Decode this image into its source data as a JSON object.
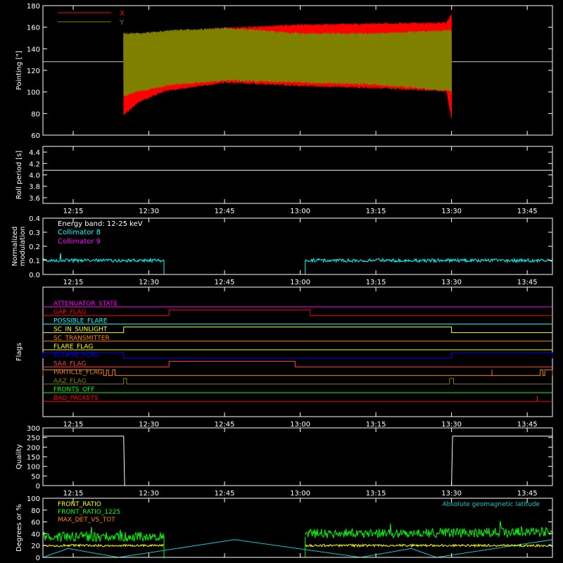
{
  "chart_data": [
    {
      "id": "pointing",
      "type": "line",
      "ylabel": "Pointing [\"]",
      "ylim": [
        60,
        180
      ],
      "yticks": [
        60,
        80,
        100,
        120,
        140,
        160,
        180
      ],
      "xticks": [
        "12:15",
        "12:30",
        "12:45",
        "13:00",
        "13:15",
        "13:30",
        "13:45"
      ],
      "show_xtick_labels": false,
      "legend": [
        {
          "name": "X",
          "color": "#ff0000"
        },
        {
          "name": "Y",
          "color": "#808000"
        }
      ],
      "reference_line": {
        "y": 128,
        "color": "#c8c8c8"
      },
      "series": [
        {
          "name": "X",
          "color": "#ff0000",
          "x_range": [
            "12:25",
            "13:30"
          ],
          "envelope_keypoints": [
            [
              "12:25",
              78,
              150
            ],
            [
              "12:28",
              90,
              150
            ],
            [
              "12:33",
              100,
              155
            ],
            [
              "12:45",
              108,
              160
            ],
            [
              "13:00",
              105,
              163
            ],
            [
              "13:15",
              103,
              164
            ],
            [
              "13:29",
              100,
              165
            ],
            [
              "13:30",
              75,
              173
            ]
          ]
        },
        {
          "name": "Y",
          "color": "#808000",
          "x_range": [
            "12:25",
            "13:30"
          ],
          "envelope_keypoints": [
            [
              "12:25",
              95,
              155
            ],
            [
              "12:28",
              100,
              155
            ],
            [
              "12:35",
              106,
              158
            ],
            [
              "12:45",
              110,
              160
            ],
            [
              "13:00",
              108,
              155
            ],
            [
              "13:15",
              106,
              155
            ],
            [
              "13:30",
              100,
              158
            ]
          ]
        }
      ]
    },
    {
      "id": "roll",
      "type": "line",
      "ylabel": "Roll period [s]",
      "ylim": [
        3.5,
        4.5
      ],
      "yticks": [
        3.6,
        3.8,
        4.0,
        4.2,
        4.4
      ],
      "xticks": [
        "12:15",
        "12:30",
        "12:45",
        "13:00",
        "13:15",
        "13:30",
        "13:45"
      ],
      "show_xtick_labels": true,
      "series": [
        {
          "name": "",
          "color": "#ffffff",
          "x": [
            "12:09",
            "13:50"
          ],
          "y": [
            4.08,
            4.08
          ]
        }
      ]
    },
    {
      "id": "modulation",
      "type": "line",
      "ylabel": "Normalized modulation",
      "ylim": [
        0.0,
        0.4
      ],
      "yticks": [
        0.0,
        0.1,
        0.2,
        0.3,
        0.4
      ],
      "xticks": [
        "12:15",
        "12:30",
        "12:45",
        "13:00",
        "13:15",
        "13:30",
        "13:45"
      ],
      "show_xtick_labels": true,
      "annotation": "Energy band: 12-25 keV",
      "series": [
        {
          "name": "Collimator 8",
          "color": "#00ffff",
          "segments": [
            [
              [
                "12:09",
                0.1
              ],
              [
                "12:33",
                0.1
              ]
            ],
            [
              [
                "13:01",
                0.1
              ],
              [
                "13:50",
                0.1
              ]
            ]
          ],
          "baseline_gap": [
            "12:33",
            "13:01"
          ]
        },
        {
          "name": "Collimator 9",
          "color": "#ff00ff",
          "x": [
            "12:09",
            "13:50"
          ],
          "y": [
            0.0,
            0.0
          ]
        }
      ]
    },
    {
      "id": "flags",
      "type": "line",
      "ylabel": "Flags",
      "xticks": [
        "12:15",
        "12:30",
        "12:45",
        "13:00",
        "13:15",
        "13:30",
        "13:45"
      ],
      "show_xtick_labels": true,
      "flags": [
        {
          "name": "ATTENUATOR_STATE",
          "color": "#ff00ff",
          "highs": []
        },
        {
          "name": "GAP_FLAG",
          "color": "#ff0000",
          "highs": [
            [
              "12:34",
              "13:02"
            ]
          ]
        },
        {
          "name": "POSSIBLE_FLARE",
          "color": "#00ffff",
          "highs": []
        },
        {
          "name": "SC_IN_SUNLIGHT",
          "color": "#ffff00",
          "highs": [
            [
              "12:25",
              "13:30"
            ]
          ]
        },
        {
          "name": "SC_TRANSMITTER",
          "color": "#ff8000",
          "highs": []
        },
        {
          "name": "FLARE_FLAG",
          "color": "#ffff00",
          "highs": []
        },
        {
          "name": "ECLIPSE_FLAG",
          "color": "#0000ff",
          "highs": [
            [
              "12:09",
              "12:25"
            ],
            [
              "13:30",
              "13:50"
            ]
          ]
        },
        {
          "name": "SAA_FLAG",
          "color": "#ff4040",
          "highs": [
            [
              "12:34",
              "12:59"
            ]
          ]
        },
        {
          "name": "PARTICLE_FLAG",
          "color": "#ff8000",
          "highs": [
            [
              "12:09",
              "12:21"
            ],
            [
              "12:21.6",
              "12:22"
            ],
            [
              "12:22.8",
              "12:23.3"
            ],
            [
              "13:47.6",
              "13:48.1"
            ],
            [
              "13:48.5",
              "13:50"
            ]
          ],
          "spikes": [
            "13:38"
          ]
        },
        {
          "name": "AAZ_FLAG",
          "color": "#808000",
          "highs": [
            [
              "12:25",
              "12:25.6"
            ],
            [
              "13:29.6",
              "13:30.4"
            ]
          ]
        },
        {
          "name": "FRONTS_OFF",
          "color": "#00ff00",
          "highs": []
        },
        {
          "name": "BAD_PACKETS",
          "color": "#ff0000",
          "highs": [],
          "spikes": [
            "13:47"
          ]
        }
      ]
    },
    {
      "id": "quality",
      "type": "line",
      "ylabel": "Quality",
      "ylim": [
        0,
        300
      ],
      "yticks": [
        0,
        50,
        100,
        150,
        200,
        250,
        300
      ],
      "xticks": [
        "12:15",
        "12:30",
        "12:45",
        "13:00",
        "13:15",
        "13:30",
        "13:45"
      ],
      "show_xtick_labels": true,
      "series": [
        {
          "name": "",
          "color": "#ffffff",
          "x": [
            "12:09",
            "12:25",
            "12:25.2",
            "13:30",
            "13:30.2",
            "13:50"
          ],
          "y": [
            257,
            257,
            0,
            0,
            257,
            257
          ]
        }
      ]
    },
    {
      "id": "front_ratio",
      "type": "line",
      "ylabel": "Degrees or %",
      "ylim": [
        0,
        100
      ],
      "yticks": [
        0,
        20,
        40,
        60,
        80,
        100
      ],
      "xticks": [
        "12:15",
        "12:30",
        "12:45",
        "13:00",
        "13:15",
        "13:30",
        "13:45"
      ],
      "show_xtick_labels": false,
      "legend_right": "Absolute geomagnetic latitude",
      "series": [
        {
          "name": "FRONT_RATIO",
          "color": "#ffff00",
          "segments": [
            [
              [
                "12:09",
                20
              ],
              [
                "12:33",
                20
              ]
            ],
            [
              [
                "13:01",
                20
              ],
              [
                "13:50",
                20
              ]
            ]
          ]
        },
        {
          "name": "FRONT_RATIO_1225",
          "color": "#00ff00",
          "segments": [
            [
              [
                "12:09",
                35
              ],
              [
                "12:33",
                35
              ]
            ],
            [
              [
                "13:01",
                40
              ],
              [
                "13:50",
                43
              ]
            ]
          ]
        },
        {
          "name": "MAX_DET_VS_TOT",
          "color": "#ff8000",
          "segments": []
        },
        {
          "name": "Absolute geomagnetic latitude",
          "color": "#00cccc",
          "x": [
            "12:09",
            "12:14",
            "12:24",
            "12:47",
            "13:12",
            "13:22",
            "13:27",
            "13:50"
          ],
          "y": [
            0,
            15,
            0,
            30,
            0,
            15,
            0,
            30
          ]
        }
      ]
    }
  ]
}
